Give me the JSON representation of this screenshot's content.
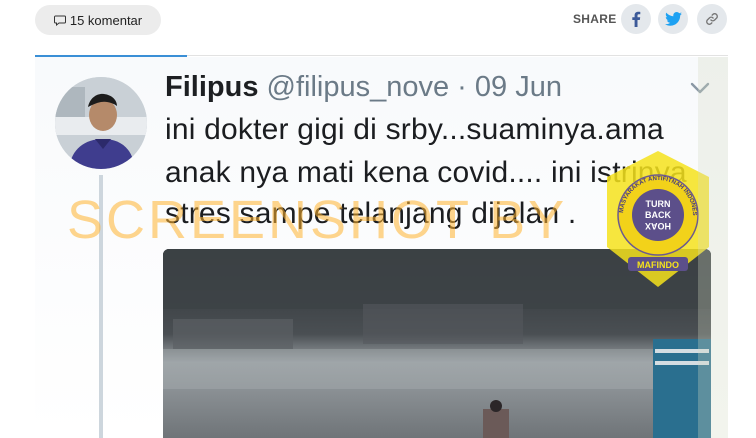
{
  "article": {
    "comments_label": "15 komentar",
    "share_label": "SHARE"
  },
  "share_buttons": [
    {
      "icon": "facebook-icon",
      "color": "#3b5998"
    },
    {
      "icon": "twitter-icon",
      "color": "#1da1f2"
    },
    {
      "icon": "link-icon",
      "color": "#777777"
    }
  ],
  "tweet": {
    "username": "Filipus",
    "handle_date": " @filipus_nove · 09 Jun",
    "lines": [
      "ini dokter gigi di srby...suaminya.ama",
      "anak nya mati kena covid.... ini istrinya",
      "stres sampe telanjang dijalan ."
    ]
  },
  "watermark": {
    "text": "SCREENSHOT BY"
  },
  "badge": {
    "ring_text_top": "MASYARAKAT ANTIFITNAH INDONESIA",
    "logo_lines": [
      "TURN",
      "BACK",
      "HOAX"
    ],
    "bottom_text": "MAFINDO"
  },
  "colors": {
    "accent_blue": "#3a8fd6",
    "watermark_orange": "#ffb32f",
    "badge_yellow": "#f4e21c"
  }
}
